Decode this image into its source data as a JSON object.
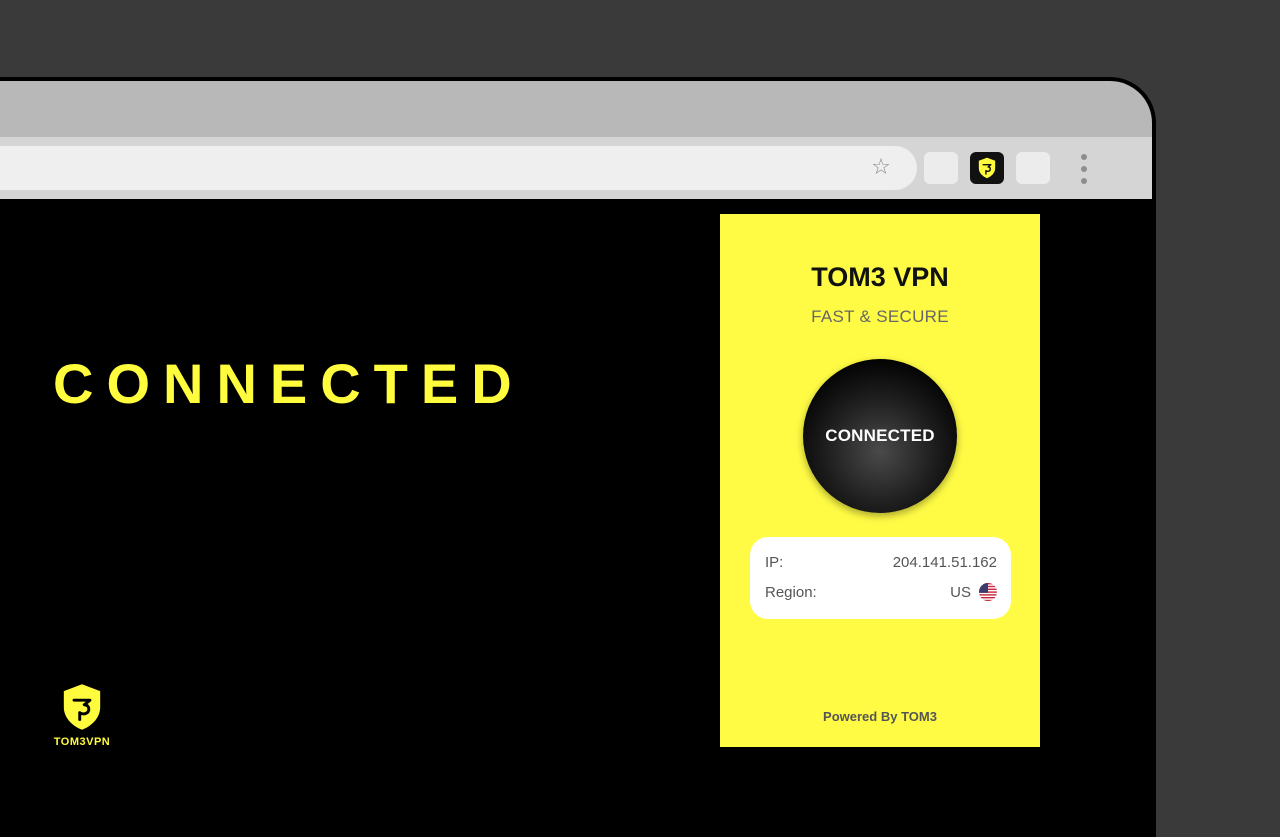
{
  "hero": {
    "status_text": "CONNECTED"
  },
  "brand": {
    "logo_text": "TOM3VPN"
  },
  "extension_popup": {
    "title": "TOM3 VPN",
    "subtitle": "FAST & SECURE",
    "connect_button_label": "CONNECTED",
    "info": {
      "ip_label": "IP:",
      "ip_value": "204.141.51.162",
      "region_label": "Region:",
      "region_value": "US",
      "region_flag_icon": "us-flag-icon"
    },
    "footer": "Powered By TOM3"
  },
  "browser": {
    "bookmark_icon": "star-icon",
    "extension_icon": "tom3-shield-icon",
    "menu_icon": "kebab-menu-icon"
  },
  "colors": {
    "accent_yellow": "#fffb3d",
    "popup_bg": "#fffb45",
    "page_bg": "#000000",
    "frame_bg": "#3a3a3a"
  }
}
